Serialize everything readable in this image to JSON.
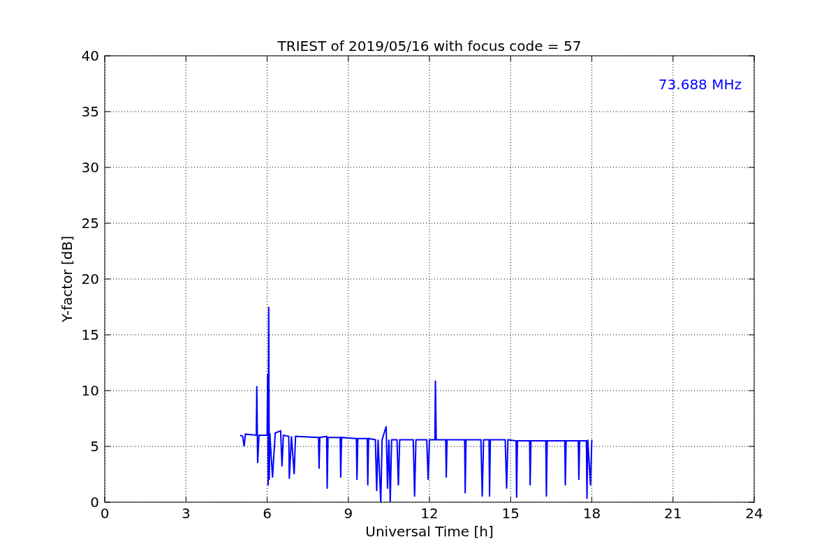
{
  "chart_data": {
    "type": "line",
    "title": "TRIEST of 2019/05/16 with focus code = 57",
    "xlabel": "Universal Time [h]",
    "ylabel": "Y-factor [dB]",
    "xlim": [
      0,
      24
    ],
    "ylim": [
      0,
      40
    ],
    "xticks": [
      0,
      3,
      6,
      9,
      12,
      15,
      18,
      21,
      24
    ],
    "yticks": [
      0,
      5,
      10,
      15,
      20,
      25,
      30,
      35,
      40
    ],
    "x": [
      5.0,
      5.1,
      5.15,
      5.2,
      5.6,
      5.62,
      5.65,
      5.7,
      6.0,
      6.02,
      6.04,
      6.06,
      6.08,
      6.1,
      6.2,
      6.3,
      6.5,
      6.55,
      6.6,
      6.8,
      6.82,
      6.9,
      7.0,
      7.05,
      7.9,
      7.92,
      7.95,
      8.2,
      8.22,
      8.25,
      8.7,
      8.72,
      8.75,
      9.3,
      9.32,
      9.35,
      9.7,
      9.72,
      9.75,
      10.0,
      10.05,
      10.1,
      10.2,
      10.25,
      10.4,
      10.45,
      10.5,
      10.55,
      10.6,
      10.8,
      10.85,
      10.9,
      11.4,
      11.45,
      11.5,
      11.9,
      11.95,
      12.0,
      12.2,
      12.22,
      12.25,
      12.6,
      12.62,
      12.65,
      13.3,
      13.32,
      13.35,
      13.9,
      13.95,
      14.0,
      14.2,
      14.22,
      14.25,
      14.8,
      14.85,
      14.9,
      15.2,
      15.22,
      15.25,
      15.7,
      15.72,
      15.75,
      16.3,
      16.32,
      16.35,
      17.0,
      17.02,
      17.05,
      17.5,
      17.52,
      17.55,
      17.8,
      17.82,
      17.85,
      17.95,
      18.0
    ],
    "series": [
      {
        "name": "73.688 MHz",
        "color": "#0000ff",
        "values": [
          6.0,
          5.9,
          5.0,
          6.1,
          6.0,
          10.4,
          3.5,
          6.0,
          6.0,
          11.5,
          1.5,
          17.5,
          2.0,
          6.2,
          2.2,
          6.2,
          6.4,
          3.2,
          6.0,
          5.9,
          2.1,
          5.9,
          2.5,
          5.9,
          5.8,
          3.0,
          5.8,
          5.9,
          1.2,
          5.8,
          5.8,
          2.2,
          5.8,
          5.7,
          2.0,
          5.7,
          5.7,
          1.5,
          5.7,
          5.6,
          1.0,
          5.6,
          0.0,
          5.6,
          6.8,
          1.2,
          5.6,
          0.0,
          5.6,
          5.6,
          1.5,
          5.6,
          5.6,
          0.5,
          5.6,
          5.6,
          2.0,
          5.6,
          5.6,
          10.9,
          5.6,
          5.6,
          2.2,
          5.6,
          5.6,
          0.8,
          5.6,
          5.6,
          0.5,
          5.6,
          5.6,
          0.5,
          5.6,
          5.6,
          1.2,
          5.6,
          5.5,
          0.4,
          5.5,
          5.5,
          1.5,
          5.5,
          5.5,
          0.5,
          5.5,
          5.5,
          1.5,
          5.5,
          5.5,
          2.0,
          5.5,
          5.5,
          0.3,
          5.6,
          1.5,
          5.6
        ]
      }
    ],
    "grid": true
  }
}
